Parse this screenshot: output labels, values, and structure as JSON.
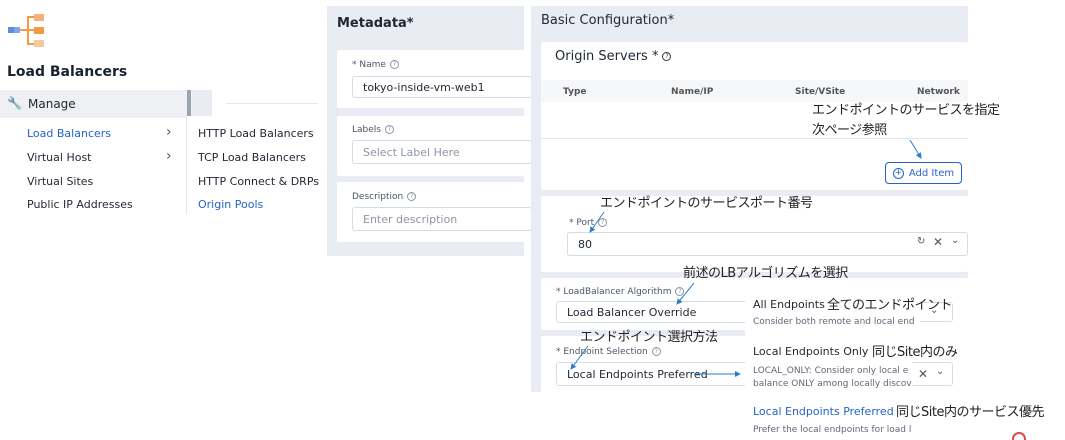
{
  "sidebar": {
    "title": "Load Balancers",
    "manage_label": "Manage",
    "items": [
      {
        "label": "Load Balancers",
        "chevron": "›"
      },
      {
        "label": "Virtual Host",
        "chevron": "›"
      },
      {
        "label": "Virtual Sites"
      },
      {
        "label": "Public IP Addresses"
      }
    ],
    "submenu": [
      "HTTP Load Balancers",
      "TCP Load Balancers",
      "HTTP Connect & DRPs",
      "Origin Pools"
    ]
  },
  "metadata": {
    "title": "Metadata*",
    "name_label": "* Name",
    "name_value": "tokyo-inside-vm-web1",
    "labels_label": "Labels",
    "labels_placeholder": "Select Label Here",
    "description_label": "Description",
    "description_placeholder": "Enter description"
  },
  "basic": {
    "title": "Basic Configuration*",
    "origin_servers_title": "Origin Servers *",
    "table_headers": [
      "Type",
      "Name/IP",
      "Site/VSite",
      "Network"
    ],
    "add_item_label": "Add Item",
    "port_label": "* Port",
    "port_value": "80",
    "lb_algorithm_label": "* LoadBalancer Algorithm",
    "lb_algorithm_value": "Load Balancer Override",
    "endpoint_selection_label": "* Endpoint Selection",
    "endpoint_selection_value": "Local Endpoints Preferred"
  },
  "dropdown": {
    "options": [
      {
        "title": "All Endpoints",
        "desc": "Consider both remote and local end"
      },
      {
        "title": "Local Endpoints Only",
        "desc1": "LOCAL_ONLY: Consider only local e",
        "desc2": "balance ONLY among locally discov"
      },
      {
        "title": "Local Endpoints Preferred",
        "desc": "Prefer the local endpoints for load l"
      }
    ]
  },
  "annotations": {
    "service_line1": "エンドポイントのサービスを指定",
    "service_line2": "次ページ参照",
    "port": "エンドポイントのサービスポート番号",
    "lb": "前述のLBアルゴリズムを選択",
    "selection": "エンドポイント選択方法",
    "all": "全てのエンドポイント",
    "local_only": "同じSite内のみ",
    "local_pref": "同じSite内のサービス優先"
  },
  "colors": {
    "accent_blue": "#2563c9",
    "panel_gray": "#e9ecf2",
    "arrow_blue": "#2a7fc9",
    "logo_orange": "#f29a45",
    "logo_blue": "#5b8fd8"
  }
}
